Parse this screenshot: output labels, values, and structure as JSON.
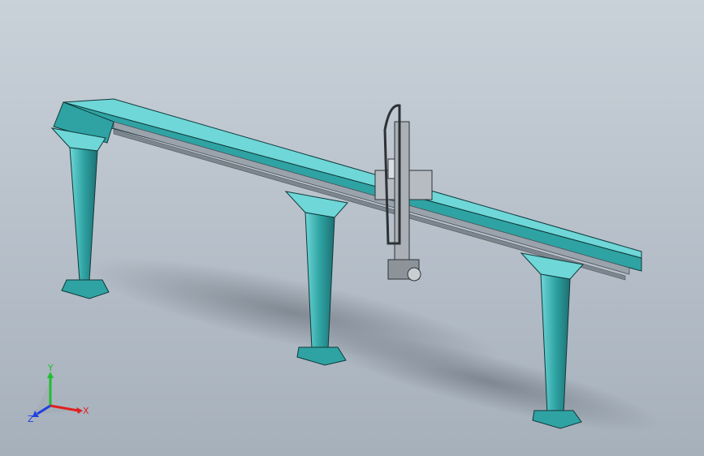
{
  "viewport": {
    "background_top": "#c9d1d9",
    "background_bottom": "#a6b0bb",
    "model": {
      "body_color": "#2fa3a3",
      "body_light": "#6fd7d7",
      "body_dark": "#1d6f72",
      "rail_color": "#9aa3ab",
      "carriage_color": "#b7bcc2"
    }
  },
  "triad": {
    "x_label": "X",
    "y_label": "Y",
    "z_label": "Z",
    "x_color": "#e02020",
    "y_color": "#1fbf2f",
    "z_color": "#2040e0"
  }
}
